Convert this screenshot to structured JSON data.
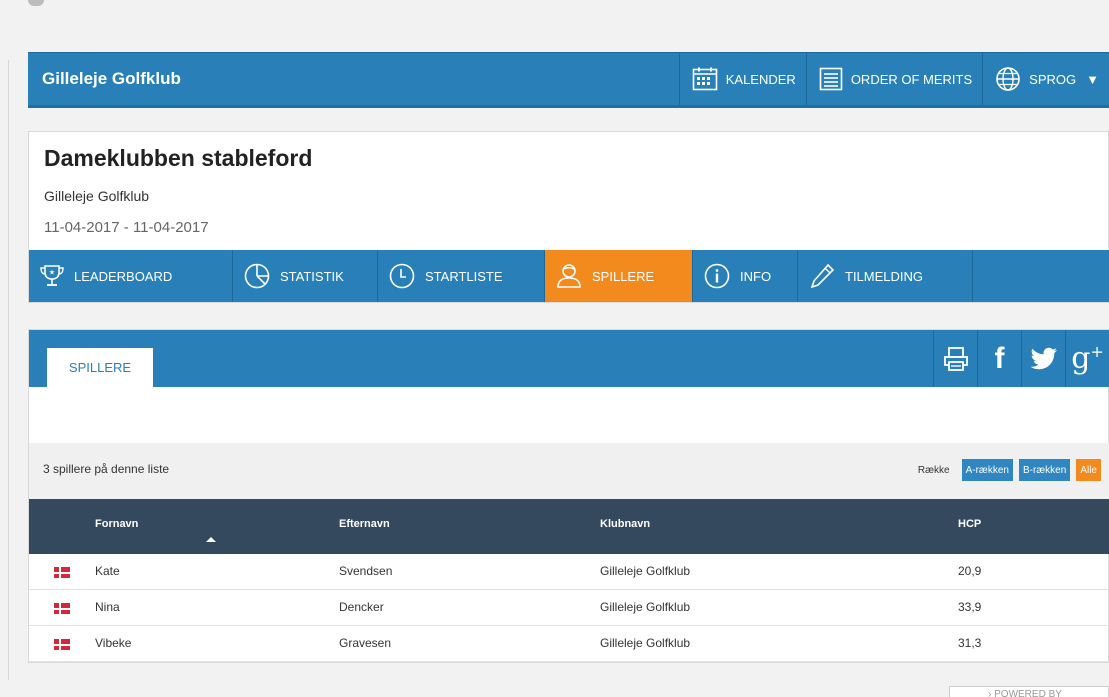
{
  "header": {
    "brand": "Gilleleje Golfklub",
    "nav": [
      {
        "label": "KALENDER",
        "icon": "calendar-icon"
      },
      {
        "label": "ORDER OF MERITS",
        "icon": "list-icon"
      },
      {
        "label": "SPROG",
        "icon": "globe-icon"
      }
    ]
  },
  "event": {
    "title": "Dameklubben stableford",
    "club": "Gilleleje Golfklub",
    "date": "11-04-2017 - 11-04-2017",
    "tabs": [
      {
        "label": "LEADERBOARD",
        "icon": "trophy-icon"
      },
      {
        "label": "STATISTIK",
        "icon": "pie-chart-icon"
      },
      {
        "label": "STARTLISTE",
        "icon": "clock-icon"
      },
      {
        "label": "SPILLERE",
        "icon": "user-icon",
        "active": true
      },
      {
        "label": "INFO",
        "icon": "info-icon"
      },
      {
        "label": "TILMELDING",
        "icon": "pen-icon"
      }
    ]
  },
  "panel": {
    "subtab": "SPILLERE",
    "share_icons": [
      "print-icon",
      "facebook-icon",
      "twitter-icon",
      "google-plus-icon"
    ],
    "count_text": "3 spillere på denne liste",
    "filter_label": "Række",
    "filters": [
      {
        "label": "A-rækken",
        "active": false
      },
      {
        "label": "B-rækken",
        "active": false
      },
      {
        "label": "Alle",
        "active": true
      }
    ],
    "columns": [
      "Fornavn",
      "Efternavn",
      "Klubnavn",
      "HCP"
    ],
    "rows": [
      {
        "fornavn": "Kate",
        "efternavn": "Svendsen",
        "klubnavn": "Gilleleje Golfklub",
        "hcp": "20,9"
      },
      {
        "fornavn": "Nina",
        "efternavn": "Dencker",
        "klubnavn": "Gilleleje Golfklub",
        "hcp": "33,9"
      },
      {
        "fornavn": "Vibeke",
        "efternavn": "Gravesen",
        "klubnavn": "Gilleleje Golfklub",
        "hcp": "31,3"
      }
    ]
  },
  "footer": {
    "powered": "POWERED BY"
  },
  "colors": {
    "primary": "#2980b9",
    "accent": "#f28a1e",
    "table_header": "#34495e"
  }
}
